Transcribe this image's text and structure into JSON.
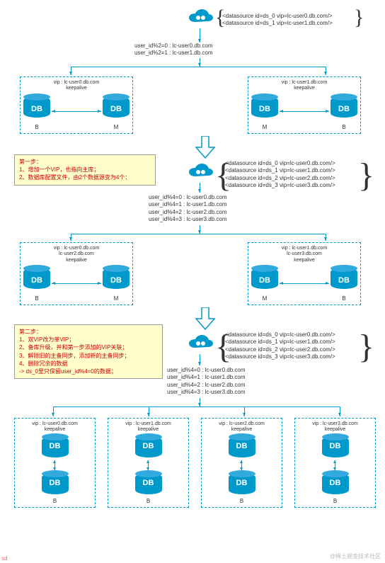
{
  "stage1": {
    "config": [
      "<datasource id=ds_0 vip=lc-user0.db.com/>",
      "<datasource id=ds_1 vip=lc-user1.db.com/>"
    ],
    "routing": [
      "user_id%2=0 : lc-user0.db.com",
      "user_id%2=1 : lc-user1.db.com"
    ],
    "left": {
      "vip": "vip : lc-user0.db.com",
      "keep": "keepalive",
      "l": "B",
      "r": "M"
    },
    "right": {
      "vip": "vip : lc-user1.db.com",
      "keep": "keepalive",
      "l": "M",
      "r": "B"
    }
  },
  "note1": {
    "title": "第一步：",
    "lines": [
      "1、增加一个VIP，也指向主库；",
      "2、数据库配置文件，由2个数据源变为4个："
    ]
  },
  "stage2": {
    "config": [
      "<datasource id=ds_0 vip=lc-user0.db.com/>",
      "<datasource id=ds_1 vip=lc-user1.db.com/>",
      "<datasource id=ds_2 vip=lc-user2.db.com/>",
      "<datasource id=ds_3 vip=lc-user3.db.com/>"
    ],
    "routing": [
      "user_id%4=0 : lc-user0.db.com",
      "user_id%4=1 : lc-user1.db.com",
      "user_id%4=2 : lc-user2.db.com",
      "user_id%4=3 : lc-user3.db.com"
    ],
    "left": {
      "vip": "vip : lc-user0.db.com",
      "vip2": "lc-user2.db.com",
      "keep": "keepalive",
      "l": "B",
      "r": "M"
    },
    "right": {
      "vip": "vip : lc-user1.db.com",
      "vip2": "lc-user3.db.com",
      "keep": "keepalive",
      "l": "M",
      "r": "B"
    }
  },
  "note2": {
    "title": "第二步：",
    "lines": [
      "1、双VIP改为单VIP；",
      "2、备库升级，并和第一步添加的VIP关联；",
      "3、解除旧的主备同步，添加新的主备同步；",
      "4、删除冗余的数据",
      "   -> ds_0里只保留user_id%4=0的数据；"
    ]
  },
  "stage3": {
    "config": [
      "<datasource id=ds_0 vip=lc-user0.db.com/>",
      "<datasource id=ds_1 vip=lc-user1.db.com/>",
      "<datasource id=ds_2 vip=lc-user2.db.com/>",
      "<datasource id=ds_3 vip=lc-user3.db.com/>"
    ],
    "routing": [
      "user_id%4=0 : lc-user0.db.com",
      "user_id%4=1 : lc-user1.db.com",
      "user_id%4=2 : lc-user2.db.com",
      "user_id%4=3 : lc-user3.db.com"
    ],
    "groups": [
      {
        "vip": "vip : lc-user0.db.com",
        "keep": "keepalive",
        "b": "B"
      },
      {
        "vip": "vip : lc-user1.db.com",
        "keep": "keepalive",
        "b": "B"
      },
      {
        "vip": "vip : lc-user2.db.com",
        "keep": "keepalive",
        "b": "B"
      },
      {
        "vip": "vip : lc-user3.db.com",
        "keep": "keepalive",
        "b": "B"
      }
    ]
  },
  "db_label": "DB",
  "watermark": "@稀土掘金技术社区",
  "sd": "sd"
}
